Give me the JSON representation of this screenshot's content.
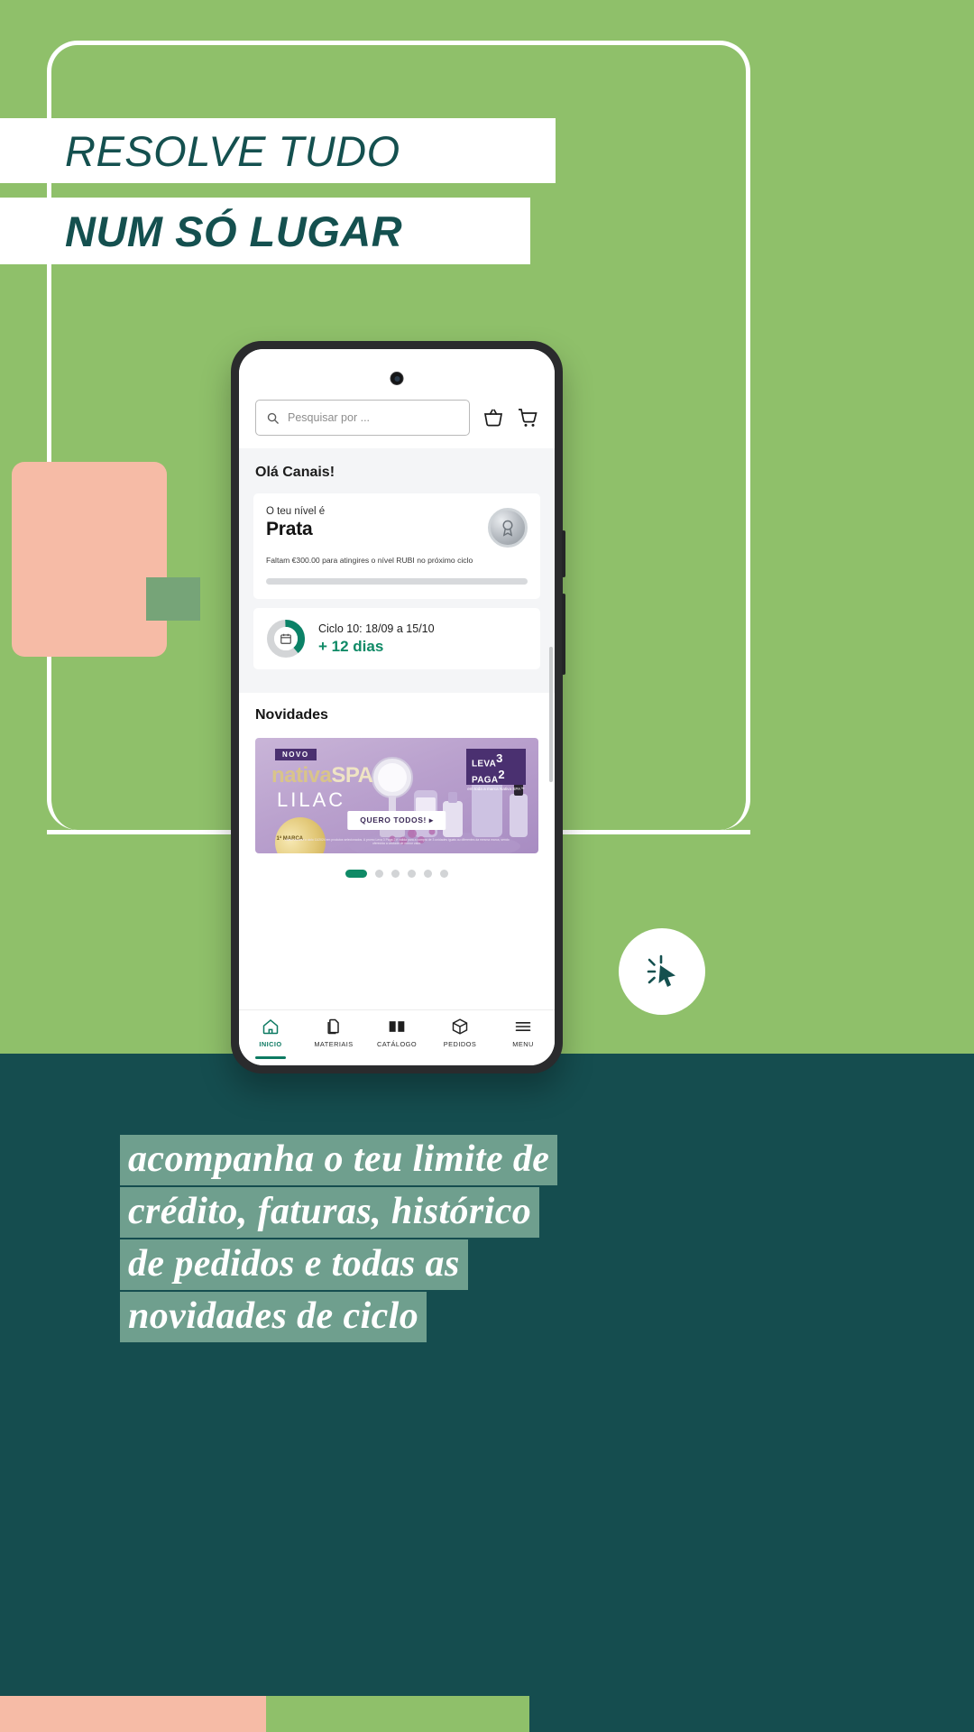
{
  "poster": {
    "headline_line1": "RESOLVE TUDO",
    "headline_line2": "NUM SÓ LUGAR",
    "caption_lines": [
      "acompanha o teu limite de",
      "crédito, faturas, histórico",
      "de pedidos e todas as",
      "novidades de ciclo"
    ],
    "colors": {
      "green": "#8fc06a",
      "teal": "#154d4f",
      "peach": "#f6bba6",
      "sage": "#76a478",
      "heading_teal": "#14504f",
      "caption_bg": "#6f9f8e",
      "accent_green": "#0f8a66"
    },
    "cursor_badge_icon": "cursor-click-icon"
  },
  "phone": {
    "search": {
      "placeholder": "Pesquisar por ...",
      "icon": "search-icon"
    },
    "top_actions": [
      {
        "name": "basket-icon",
        "label": "Cabaz"
      },
      {
        "name": "cart-icon",
        "label": "Carrinho"
      }
    ],
    "greeting": "Olá Canais!",
    "level_card": {
      "label": "O teu nível é",
      "level": "Prata",
      "note": "Faltam €300.00 para atingires o nível RUBI no próximo ciclo",
      "medal_icon": "medal-icon",
      "progress_percent": 0
    },
    "cycle_card": {
      "title": "Ciclo 10: 18/09 a 15/10",
      "remaining": "+ 12 dias",
      "icon": "calendar-icon",
      "ring_percent": 40
    },
    "news": {
      "title": "Novidades",
      "banner": {
        "tag": "NOVO",
        "brand_a": "nativa",
        "brand_b": "SPA",
        "brand_c": "LILAC",
        "seal": "1ª MARCA",
        "offer_line1": "LEVA",
        "offer_num1": "3",
        "offer_line2": "PAGA",
        "offer_num2": "2",
        "offer_sub": "em toda a marca Nativa SPA™",
        "cta": "QUERO TODOS! ▸",
        "legal": "Válido durante o ciclo 11/2024 em produtos selecionados. A promo Leva 3 Paga 2 é válida para a compra de 3 unidades iguais ou diferentes da mesma marca, sendo oferecida a unidade de menor valor."
      },
      "dots_total": 6,
      "dots_active_index": 0
    },
    "tabs": [
      {
        "label": "INICIO",
        "icon": "home-icon",
        "active": true
      },
      {
        "label": "MATERIAIS",
        "icon": "documents-icon",
        "active": false
      },
      {
        "label": "CATÁLOGO",
        "icon": "book-icon",
        "active": false
      },
      {
        "label": "PEDIDOS",
        "icon": "box-icon",
        "active": false
      },
      {
        "label": "MENU",
        "icon": "menu-icon",
        "active": false
      }
    ]
  }
}
